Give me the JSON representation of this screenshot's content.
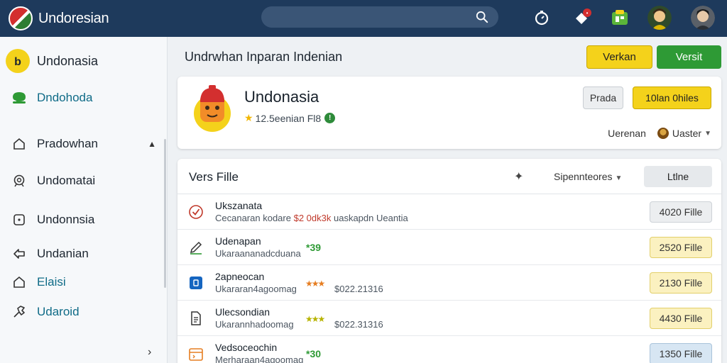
{
  "app": {
    "title": "Undoresian"
  },
  "search": {
    "placeholder": ""
  },
  "sidebar": {
    "header": "Undonasia",
    "items": [
      {
        "label": "Dndohoda",
        "icon": "chat-icon"
      },
      {
        "label": "Pradowhan",
        "icon": "home-icon"
      },
      {
        "label": "Undomatai",
        "icon": "settings-icon"
      },
      {
        "label": "Undonnsia",
        "icon": "square-icon"
      },
      {
        "label": "Undanian",
        "icon": "share-icon"
      },
      {
        "label": "Elaisi",
        "icon": "home-outline-icon"
      },
      {
        "label": "Udaroid",
        "icon": "wrench-icon"
      }
    ]
  },
  "main": {
    "title": "Undrwhan Inparan Indenian",
    "btn_yellow": "Verkan",
    "btn_green": "Versit"
  },
  "card": {
    "name": "Undonasia",
    "rating_text": "12.5eenian Fl8",
    "btn_secondary": "Prada",
    "btn_primary": "10lan 0hiles",
    "foot_left": "Uerenan",
    "foot_user": "Uaster"
  },
  "files": {
    "title": "Vers Fille",
    "sort_label": "Sipennteores",
    "header_button": "Ltlne",
    "rows": [
      {
        "name": "Ukszanata",
        "sub_a": "Cecanaran kodare",
        "sub_price": "$2 0dk3k",
        "sub_b": "uaskapdn Ueantia",
        "button": "4020 Fille",
        "icon": "check-circle-icon"
      },
      {
        "name": "Udenapan",
        "sub": "Ukaraananadcduana",
        "tag": "*39",
        "button": "2520 Fille",
        "icon": "pencil-icon"
      },
      {
        "name": "2apneocan",
        "sub": "Ukararan4agoomag",
        "stars": "★★★",
        "amount": "$022.21316",
        "button": "2130 Fille",
        "icon": "blue-square-icon"
      },
      {
        "name": "Ulecsondian",
        "sub": "Ukarannhadoomag",
        "stars": "★★★",
        "amount": "$022.31316",
        "button": "4430 Fille",
        "icon": "document-icon"
      },
      {
        "name": "Vedsoceochin",
        "sub": "Merharaan4agoomag",
        "tag": "*30",
        "button": "1350 Fille",
        "icon": "calendar-icon"
      }
    ]
  },
  "colors": {
    "topbar": "#1e3a5c",
    "accent_yellow": "#f4d21b",
    "accent_green": "#2e9a35"
  }
}
